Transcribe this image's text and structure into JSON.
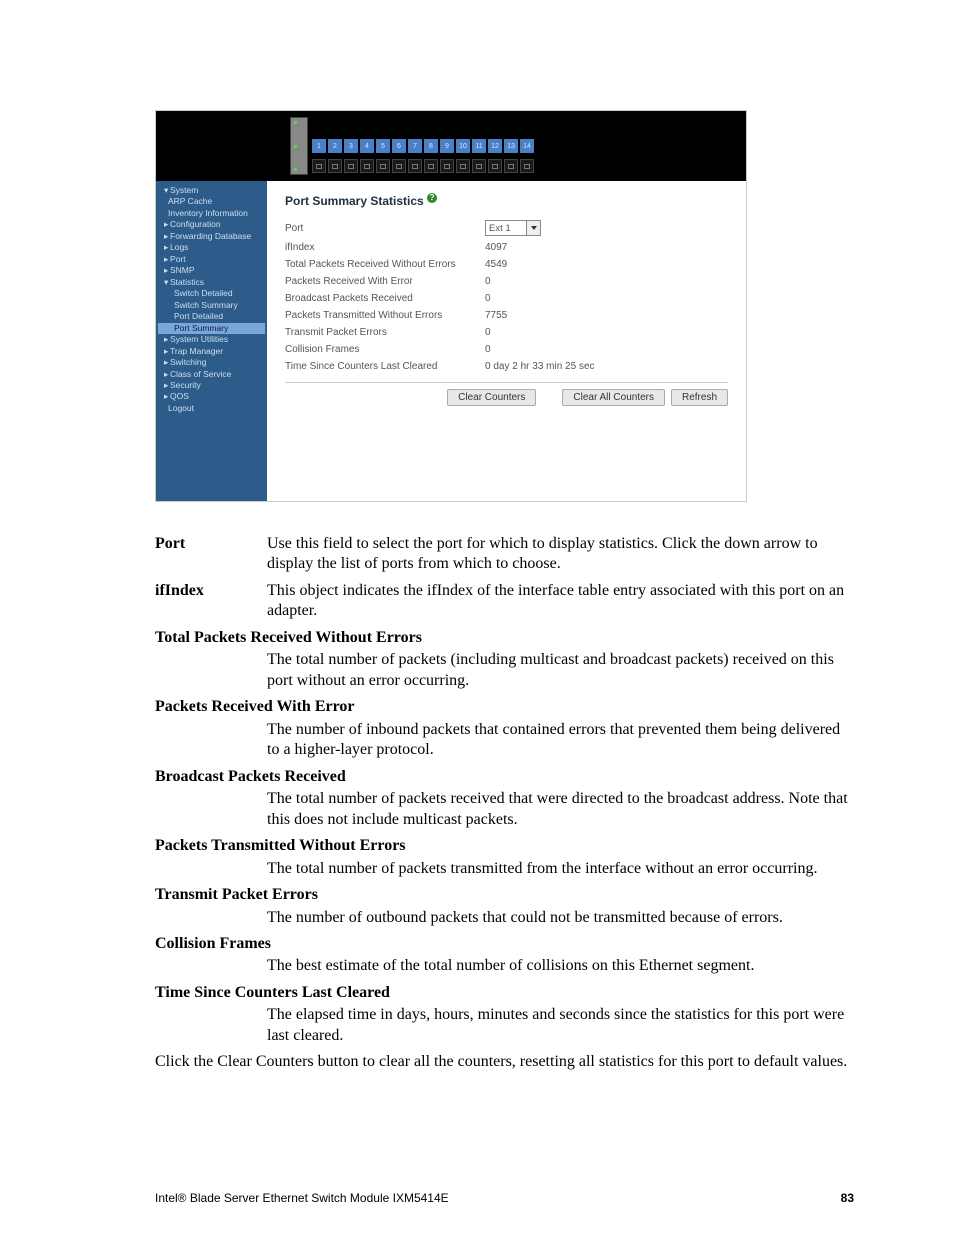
{
  "footer": {
    "product": "Intel® Blade Server Ethernet Switch Module IXM5414E",
    "page": "83"
  },
  "screenshot": {
    "port_numbers_top": [
      "1",
      "2",
      "3",
      "4",
      "5",
      "6",
      "7",
      "8",
      "9",
      "10",
      "11",
      "12",
      "13",
      "14"
    ],
    "nav": {
      "items": [
        {
          "label": "System",
          "ind": 0,
          "mk": "▾"
        },
        {
          "label": "ARP Cache",
          "ind": 1,
          "mk": ""
        },
        {
          "label": "Inventory Information",
          "ind": 1,
          "mk": ""
        },
        {
          "label": "Configuration",
          "ind": 0,
          "mk": "▸"
        },
        {
          "label": "Forwarding Database",
          "ind": 0,
          "mk": "▸"
        },
        {
          "label": "Logs",
          "ind": 0,
          "mk": "▸"
        },
        {
          "label": "Port",
          "ind": 0,
          "mk": "▸"
        },
        {
          "label": "SNMP",
          "ind": 0,
          "mk": "▸"
        },
        {
          "label": "Statistics",
          "ind": 0,
          "mk": "▾"
        },
        {
          "label": "Switch Detailed",
          "ind": 1,
          "mk": ""
        },
        {
          "label": "Switch Summary",
          "ind": 1,
          "mk": ""
        },
        {
          "label": "Port Detailed",
          "ind": 1,
          "mk": ""
        },
        {
          "label": "Port Summary",
          "ind": 1,
          "mk": "",
          "sel": true
        },
        {
          "label": "System Utilities",
          "ind": 0,
          "mk": "▸"
        },
        {
          "label": "Trap Manager",
          "ind": 0,
          "mk": "▸"
        },
        {
          "label": "Switching",
          "ind": 0,
          "mk": "▸"
        },
        {
          "label": "Class of Service",
          "ind": 0,
          "mk": "▸"
        },
        {
          "label": "Security",
          "ind": 0,
          "mk": "▸"
        },
        {
          "label": "QOS",
          "ind": 0,
          "mk": "▸"
        },
        {
          "label": "Logout",
          "ind": 1,
          "mk": ""
        }
      ]
    },
    "panel": {
      "title": "Port Summary Statistics",
      "help": "?",
      "rows": [
        {
          "label": "Port",
          "value": "Ext 1",
          "type": "select"
        },
        {
          "label": "ifIndex",
          "value": "4097"
        },
        {
          "label": "Total Packets Received Without Errors",
          "value": "4549"
        },
        {
          "label": "Packets Received With Error",
          "value": "0"
        },
        {
          "label": "Broadcast Packets Received",
          "value": "0"
        },
        {
          "label": "Packets Transmitted Without Errors",
          "value": "7755"
        },
        {
          "label": "Transmit Packet Errors",
          "value": "0"
        },
        {
          "label": "Collision Frames",
          "value": "0"
        },
        {
          "label": "Time Since Counters Last Cleared",
          "value": "0 day 2 hr 33 min 25 sec"
        }
      ],
      "buttons": {
        "clear_counters": "Clear Counters",
        "clear_all": "Clear All Counters",
        "refresh": "Refresh"
      }
    }
  },
  "defs": {
    "port": {
      "term": "Port",
      "desc": "Use this field to select the port for which to display statistics. Click the down arrow to display the list of ports from which to choose."
    },
    "ifindex": {
      "term": "ifIndex",
      "desc": "This object indicates the ifIndex of the interface table entry associated with this port on an adapter."
    },
    "tprwe": {
      "hdr": "Total Packets Received Without Errors",
      "desc": "The total number of packets (including multicast and broadcast packets) received on this port without an error occurring."
    },
    "prwe": {
      "hdr": "Packets Received With Error",
      "desc": "The number of inbound packets that contained errors that prevented them being delivered to a higher-layer protocol."
    },
    "bpr": {
      "hdr": "Broadcast Packets Received",
      "desc": "The total number of packets received that were directed to the broadcast address. Note that this does not include multicast packets."
    },
    "ptwe": {
      "hdr": "Packets Transmitted Without Errors",
      "desc": "The total number of packets transmitted from the interface without an error occurring."
    },
    "tpe": {
      "hdr": "Transmit Packet Errors",
      "desc": "The number of outbound packets that could not be transmitted because of errors."
    },
    "cf": {
      "hdr": "Collision Frames",
      "desc": "The best estimate of the total number of collisions on this Ethernet segment."
    },
    "tsclc": {
      "hdr": "Time Since Counters Last Cleared",
      "desc": "The elapsed time in days, hours, minutes and seconds since the statistics for this port were last cleared."
    },
    "closing": "Click the Clear Counters button to clear all the counters, resetting all statistics for this port to default values."
  }
}
